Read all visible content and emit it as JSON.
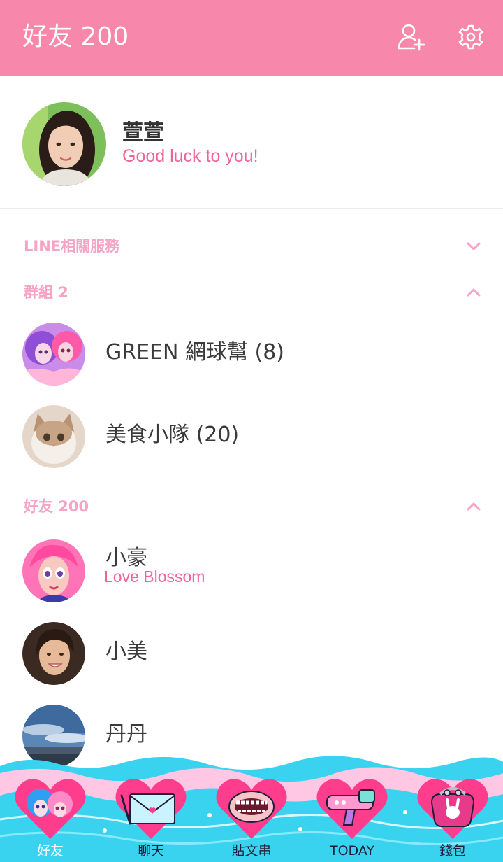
{
  "header": {
    "title": "好友 200",
    "add_friend_icon": "add-friend-icon",
    "settings_icon": "gear-icon"
  },
  "profile": {
    "name": "萱萱",
    "status": "Good luck to you!"
  },
  "sections": {
    "services": {
      "label": "LINE相關服務",
      "expanded": false
    },
    "groups": {
      "label": "群組 2",
      "expanded": true
    },
    "friends": {
      "label": "好友 200",
      "expanded": true
    }
  },
  "groups": [
    {
      "name": "GREEN 網球幫 (8)"
    },
    {
      "name": "美食小隊 (20)"
    }
  ],
  "friends": [
    {
      "name": "小豪",
      "status": "Love Blossom"
    },
    {
      "name": "小美",
      "status": ""
    },
    {
      "name": "丹丹",
      "status": ""
    }
  ],
  "tabs": [
    {
      "label": "好友",
      "active": true
    },
    {
      "label": "聊天",
      "active": false
    },
    {
      "label": "貼文串",
      "active": false
    },
    {
      "label": "TODAY",
      "active": false
    },
    {
      "label": "錢包",
      "active": false
    }
  ],
  "colors": {
    "header": "#f887ac",
    "accent": "#f0639b",
    "section_label": "#f7a3c3",
    "tab_heart": "#ff3d8d",
    "tab_wave": "#39d3f0"
  }
}
